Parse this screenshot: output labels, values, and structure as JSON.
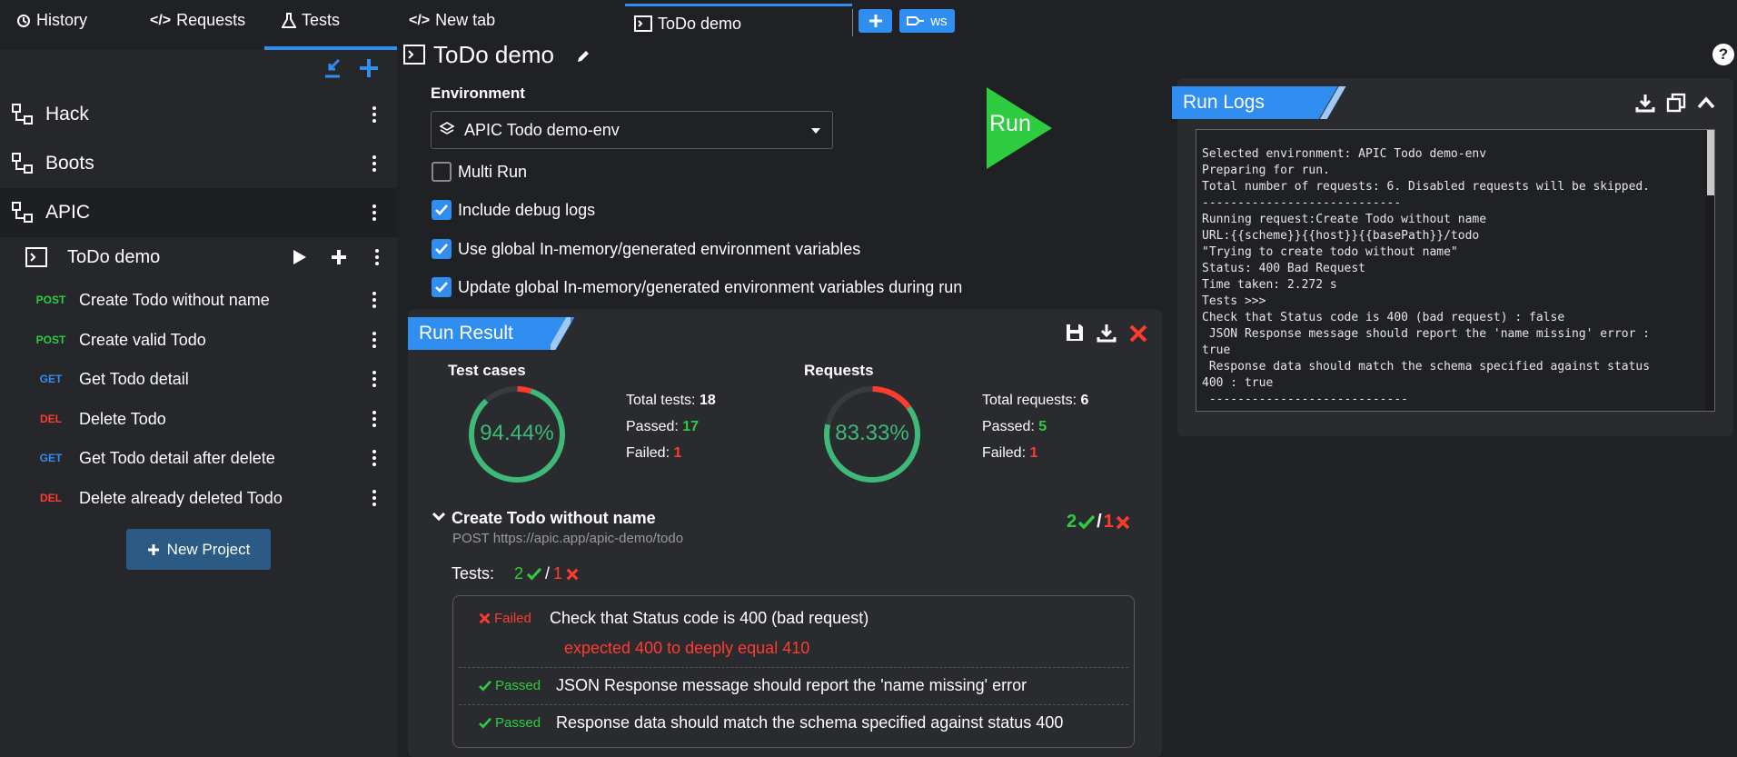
{
  "tabs": {
    "history": "History",
    "requests": "Requests",
    "tests": "Tests",
    "new_tab": "New tab",
    "active_tab": "ToDo demo",
    "ws": "ws"
  },
  "sidebar": {
    "projects": [
      {
        "name": "Hack"
      },
      {
        "name": "Boots"
      },
      {
        "name": "APIC"
      }
    ],
    "suite": "ToDo demo",
    "requests": [
      {
        "method": "POST",
        "name": "Create Todo without name"
      },
      {
        "method": "POST",
        "name": "Create valid Todo"
      },
      {
        "method": "GET",
        "name": "Get Todo detail"
      },
      {
        "method": "DEL",
        "name": "Delete Todo"
      },
      {
        "method": "GET",
        "name": "Get Todo detail after delete"
      },
      {
        "method": "DEL",
        "name": "Delete already deleted Todo"
      }
    ],
    "new_project": "New Project"
  },
  "main": {
    "title": "ToDo demo",
    "env_label": "Environment",
    "env_value": "APIC Todo demo-env",
    "run": "Run",
    "options": [
      {
        "label": "Multi Run",
        "checked": false
      },
      {
        "label": "Include debug logs",
        "checked": true
      },
      {
        "label": "Use global In-memory/generated environment variables",
        "checked": true
      },
      {
        "label": "Update global In-memory/generated environment variables during run",
        "checked": true
      }
    ]
  },
  "result": {
    "title": "Run Result",
    "tc_title": "Test cases",
    "tc_percent": "94.44%",
    "tc_fraction": 0.9444,
    "total_tests_label": "Total tests:",
    "total_tests": "18",
    "passed_label": "Passed:",
    "tests_passed": "17",
    "failed_label": "Failed:",
    "tests_failed": "1",
    "req_title": "Requests",
    "req_percent": "83.33%",
    "req_fraction": 0.8333,
    "total_requests_label": "Total requests:",
    "total_requests": "6",
    "req_passed": "5",
    "req_failed": "1",
    "item_name": "Create Todo without name",
    "item_url": "POST https://apic.app/apic-demo/todo",
    "item_pass": "2",
    "item_fail": "1",
    "sep": "/",
    "tests_label": "Tests:",
    "cases": [
      {
        "status": "Failed",
        "text": "Check that Status code is 400 (bad request)",
        "err": "expected 400 to deeply equal 410"
      },
      {
        "status": "Passed",
        "text": "JSON Response message should report the 'name missing' error"
      },
      {
        "status": "Passed",
        "text": "Response data should match the schema specified against status 400"
      }
    ]
  },
  "logs": {
    "title": "Run Logs",
    "lines": [
      "Selected environment: APIC Todo demo-env",
      "Preparing for run.",
      "Total number of requests: 6. Disabled requests will be skipped.",
      "----------------------------",
      "Running request:Create Todo without name",
      "URL:{{scheme}}{{host}}{{basePath}}/todo",
      "\"Trying to create todo without name\"",
      "Status: 400 Bad Request",
      "Time taken: 2.272 s",
      "Tests >>>",
      "Check that Status code is 400 (bad request) : false",
      " JSON Response message should report the 'name missing' error :",
      "true",
      " Response data should match the schema specified against status",
      "400 : true",
      " ----------------------------"
    ]
  },
  "colors": {
    "accent": "#2f8ef0",
    "pass": "#2ecc40",
    "fail": "#ff3b30",
    "gauge_pass": "#3dba78"
  }
}
